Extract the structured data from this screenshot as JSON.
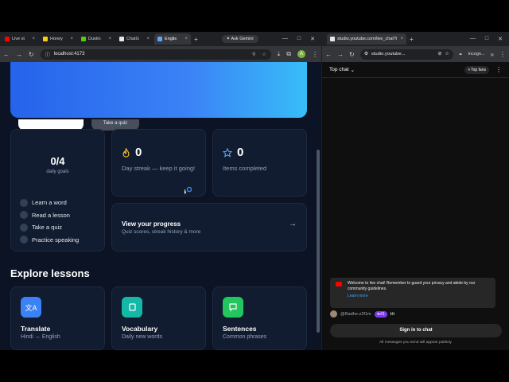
{
  "left_browser": {
    "tabs": [
      {
        "label": "Live st",
        "color": "#ff0000"
      },
      {
        "label": "Honey",
        "color": "#facc15"
      },
      {
        "label": "Duolin",
        "color": "#58cc02"
      },
      {
        "label": "ChatG",
        "color": "#e5e7eb"
      },
      {
        "label": "Englis",
        "color": "#60a5fa",
        "active": true
      }
    ],
    "gemini_label": "Ask Gemini",
    "url": "localhost:4173",
    "profile_initial": "A"
  },
  "hero": {
    "secondary_button": "Take a quiz"
  },
  "goals": {
    "value": "0/4",
    "label": "daily goals",
    "items": [
      "Learn a word",
      "Read a lesson",
      "Take a quiz",
      "Practice speaking"
    ]
  },
  "streak": {
    "value": "0",
    "label": "Day streak — keep it going!"
  },
  "completed": {
    "value": "0",
    "label": "Items completed"
  },
  "progress": {
    "title": "View your progress",
    "subtitle": "Quiz scores, streak history & more",
    "arrow": "→"
  },
  "explore": {
    "title": "Explore lessons",
    "lessons": [
      {
        "title": "Translate",
        "subtitle": "Hindi ↔ English",
        "color": "#3b82f6",
        "icon": "translate-icon"
      },
      {
        "title": "Vocabulary",
        "subtitle": "Daily new words",
        "color": "#14b8a6",
        "icon": "book-icon"
      },
      {
        "title": "Sentences",
        "subtitle": "Common phrases",
        "color": "#22c55e",
        "icon": "chat-icon"
      }
    ],
    "more": [
      {
        "color": "#f59e0b",
        "icon": "pencil-icon"
      },
      {
        "color": "#e11d48",
        "icon": "mic-icon"
      },
      {
        "color": "#a855f7",
        "icon": "speaker-icon"
      }
    ]
  },
  "right_browser": {
    "tab_label": "studio.youtube.com/live_chat?i",
    "url": "studio.youtube...",
    "incognito": "Incogn..."
  },
  "chat": {
    "header": "Top chat",
    "top_fans": "Top fans",
    "welcome": "Welcome to live chat! Remember to guard your privacy and abide by our community guidelines.",
    "learn_more": "Learn more",
    "author": "@Radhe-z2f1m",
    "badge": "#1",
    "message": "Hi",
    "sign_in": "Sign in to chat",
    "note": "All messages you send will appear publicly"
  }
}
